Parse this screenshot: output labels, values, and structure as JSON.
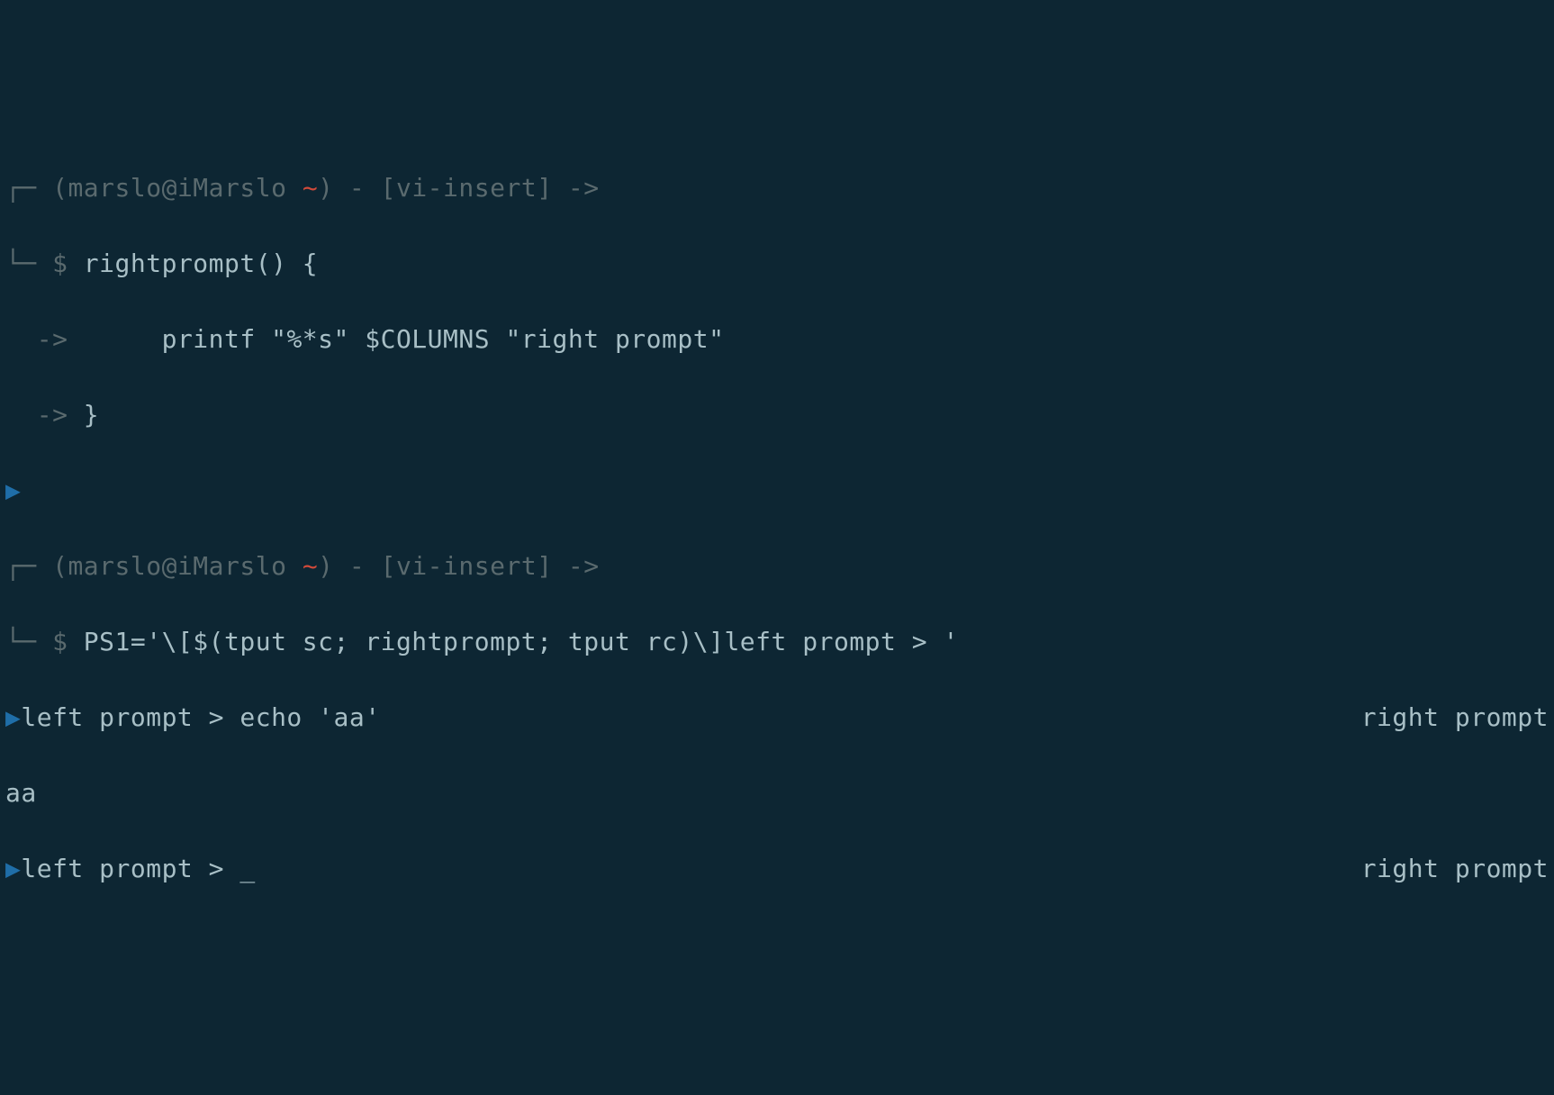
{
  "block1": {
    "header": {
      "bracket_open": "┌─ ",
      "paren_open": "(",
      "user_host": "marslo@iMarslo ",
      "tilde": "~",
      "paren_close": ")",
      "sep1": " - ",
      "mode_open": "[",
      "mode": "vi-insert",
      "mode_close": "]",
      "arrow": " ->"
    },
    "prompt_line": {
      "bracket": "└─ ",
      "sym": "$ ",
      "cmd": "rightprompt() {"
    },
    "cont1": {
      "arrow": "  -> ",
      "text": "     printf \"%*s\" $COLUMNS \"right prompt\""
    },
    "cont2": {
      "arrow": "  -> ",
      "text": "}"
    }
  },
  "divider_mark": "▶",
  "block2": {
    "header": {
      "bracket_open": "┌─ ",
      "paren_open": "(",
      "user_host": "marslo@iMarslo ",
      "tilde": "~",
      "paren_close": ")",
      "sep1": " - ",
      "mode_open": "[",
      "mode": "vi-insert",
      "mode_close": "]",
      "arrow": " ->"
    },
    "prompt_line": {
      "bracket": "└─ ",
      "sym": "$ ",
      "cmd": "PS1='\\[$(tput sc; rightprompt; tput rc)\\]left prompt > '"
    }
  },
  "result1": {
    "mark": "▶",
    "left": "left prompt > echo 'aa'",
    "right": "right prompt"
  },
  "output1": "aa",
  "result2": {
    "mark": "▶",
    "left": "left prompt > ",
    "cursor": "_",
    "right": "right prompt"
  }
}
